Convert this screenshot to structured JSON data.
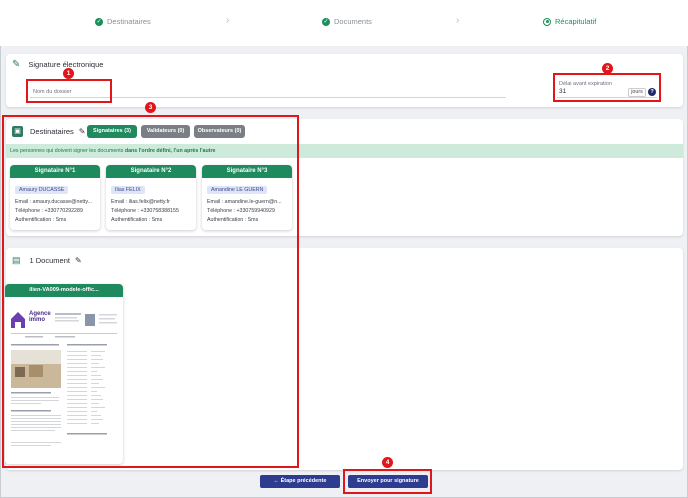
{
  "stepper": {
    "steps": [
      {
        "label": "Destinataires"
      },
      {
        "label": "Documents"
      },
      {
        "label": "Récapitulatif"
      }
    ]
  },
  "signature": {
    "title": "Signature électronique",
    "dossier_placeholder": "Nom du dossier",
    "expiry_label": "Délai avant expiration",
    "expiry_value": "31",
    "expiry_unit": "jours",
    "help": "?"
  },
  "destinataires": {
    "title": "Destinataires",
    "tabs": [
      {
        "label": "Signataires (3)",
        "color": "#1f8a5d"
      },
      {
        "label": "Validateurs (0)",
        "color": "#7a7f86"
      },
      {
        "label": "Observateurs (0)",
        "color": "#7a7f86"
      }
    ],
    "info_prefix": "Les personnes qui doivent signer les documents ",
    "info_bold": "dans l'ordre défini, l'un après l'autre",
    "signers": [
      {
        "head": "Signataire N°1",
        "name": "Amaury DUCASSE",
        "email": "Email : amaury.ducasse@netty...",
        "phone": "Téléphone : +330770292289",
        "auth": "Authentification : Sms"
      },
      {
        "head": "Signataire N°2",
        "name": "Ilias FELIX",
        "email": "Email : ilias.felix@netty.fr",
        "phone": "Téléphone : +330758388155",
        "auth": "Authentification : Sms"
      },
      {
        "head": "Signataire N°3",
        "name": "Amandine LE GUERN",
        "email": "Email : amandine.le-guern@n...",
        "phone": "Téléphone : +330759940929",
        "auth": "Authentification : Sms"
      }
    ]
  },
  "documents": {
    "title": "1 Document",
    "file_name": "ilien-VA009-modele-offic...",
    "logo_line1": "Agence",
    "logo_line2": "immo"
  },
  "footer": {
    "prev_label": "Étape précédente",
    "send_label": "Envoyer pour signature"
  },
  "annotations": [
    "1",
    "2",
    "3",
    "4"
  ],
  "colors": {
    "accent": "#1f8a5d",
    "primary_button": "#2e3c8f",
    "highlight": "#e0161b"
  }
}
